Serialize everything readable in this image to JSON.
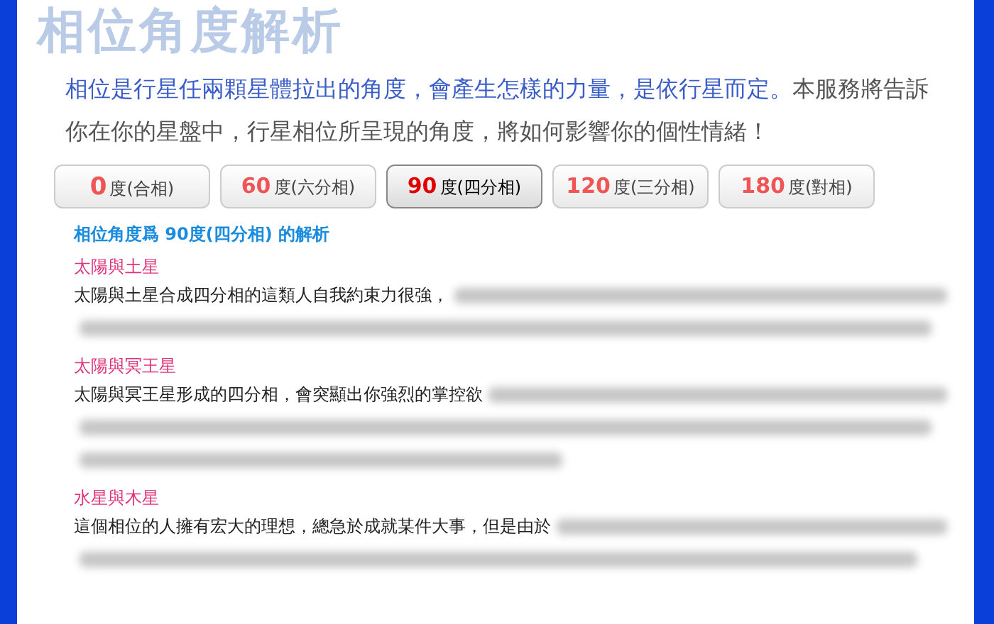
{
  "banner": {
    "title": "相位角度解析"
  },
  "intro": [
    {
      "kind": "lead",
      "text": "相位是行星任兩顆星體拉出的角度，會產生怎樣的力量，是依行星而定。"
    },
    {
      "kind": "body",
      "text": "本服務將告訴你在你的星盤中，行星相位所呈現的角度，將如何影響你的個性情緒！"
    }
  ],
  "tabs": [
    {
      "degree": "0",
      "label": "度(合相)",
      "selected": false
    },
    {
      "degree": "60",
      "label": "度(六分相)",
      "selected": false
    },
    {
      "degree": "90",
      "label": "度(四分相)",
      "selected": true
    },
    {
      "degree": "120",
      "label": "度(三分相)",
      "selected": false
    },
    {
      "degree": "180",
      "label": "度(對相)",
      "selected": false
    }
  ],
  "heading": "相位角度爲 90度(四分相) 的解析",
  "sections": [
    {
      "title": "太陽與土星",
      "text": "太陽與土星合成四分相的這類人自我約束力很強，",
      "blurred": true
    },
    {
      "title": "太陽與冥王星",
      "text": "太陽與冥王星形成的四分相，會突顯出你強烈的掌控欲",
      "blurred": true
    },
    {
      "title": "水星與木星",
      "text": "這個相位的人擁有宏大的理想，總急於成就某件大事，但是由於",
      "blurred": true
    }
  ]
}
